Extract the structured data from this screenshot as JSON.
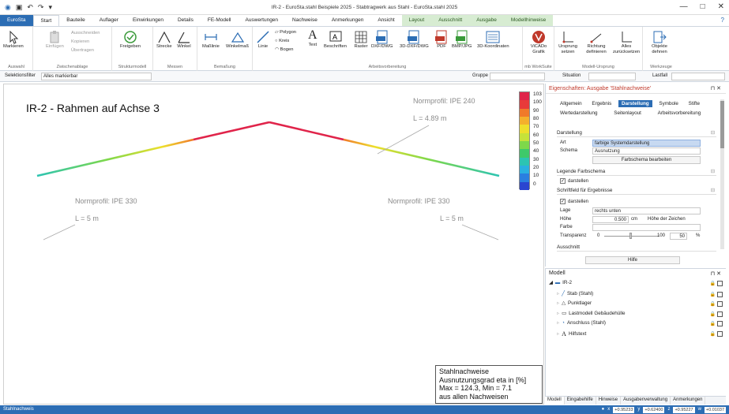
{
  "window": {
    "title": "IR-2 - EuroSta.stahl Beispiele 2025 - Stabtragwerk aus Stahl - EuroSta.stahl 2025",
    "quick_access": [
      "↶",
      "↷",
      "▾"
    ],
    "win_buttons": [
      "—",
      "□",
      "✕"
    ]
  },
  "ribbon_tabs": {
    "file": "EuroSta",
    "items": [
      "Start",
      "Bauteile",
      "Auflager",
      "Einwirkungen",
      "Details",
      "FE-Modell",
      "Auswertungen",
      "Nachweise",
      "Anmerkungen",
      "Ansicht"
    ],
    "contextual": [
      "Layout",
      "Ausschnitt",
      "Ausgabe",
      "Modellhinweise"
    ],
    "help": "?"
  },
  "ribbon": {
    "auswahl": {
      "label": "Auswahl",
      "markieren": "Markieren"
    },
    "zwischenablage": {
      "label": "Zwischenablage",
      "einfuegen": "Einfügen",
      "ausschneiden": "Ausschneiden",
      "kopieren": "Kopieren",
      "uebertragen": "Übertragen"
    },
    "strukturmodell": {
      "label": "Strukturmodell",
      "freigeben": "Freigeben"
    },
    "messen": {
      "label": "Messen",
      "strecke": "Strecke",
      "winkel": "Winkel"
    },
    "bemassung": {
      "label": "Bemaßung",
      "masslinie": "Maßlinie",
      "winkelmass": "Winkelmaß"
    },
    "arbeitsvorbereitung": {
      "label": "Arbeitsvorbereitung",
      "linie": "Linie",
      "polygon": "Polygon",
      "kreis": "Kreis",
      "bogen": "Bogen",
      "text": "Text",
      "beschriften": "Beschriften",
      "raster": "Raster",
      "dxf": "DXF/DWG",
      "dxf3d": "3D-DXF/DWG",
      "pdf": "PDF",
      "bmp": "BMP/JPG",
      "koord3d": "3D-Koordinaten"
    },
    "mbworksuite": {
      "label": "mb WorkSuite",
      "vicado": "ViCADo Grafik"
    },
    "modellursprung": {
      "label": "Modell-Ursprung",
      "ursprung": "Ursprung setzen",
      "richtung": "Richtung definieren",
      "alles": "Alles zurücksetzen"
    },
    "werkzeuge": {
      "label": "Werkzeuge",
      "objekte": "Objekte dehnen"
    }
  },
  "filterbar": {
    "selektionsfilter_label": "Selektionsfilter",
    "selektionsfilter_value": "Alles markierbar",
    "gruppe_label": "Gruppe",
    "situation_label": "Situation",
    "lastfall_label": "Lastfall"
  },
  "canvas": {
    "title": "IR-2 - Rahmen auf Achse 3",
    "annotations": {
      "top_profile": "Normprofil: IPE 240",
      "top_length": "L = 4.89 m",
      "left_profile": "Normprofil: IPE 330",
      "left_length": "L = 5 m",
      "right_profile": "Normprofil: IPE 330",
      "right_length": "L = 5 m"
    },
    "legend": {
      "labels": [
        "103",
        "100",
        "90",
        "80",
        "70",
        "60",
        "50",
        "40",
        "30",
        "20",
        "10",
        "0"
      ],
      "colors": [
        "#e0244a",
        "#e83a3a",
        "#f07a2a",
        "#f4b02c",
        "#eedf2c",
        "#c6e23a",
        "#7ed84a",
        "#3ec96a",
        "#2cc4b2",
        "#2ab0e0",
        "#2a7fe0",
        "#2a45d0"
      ]
    },
    "result": {
      "line1": "Stahlnachweise",
      "line2": "Ausnutzungsgrad eta in [%]",
      "line3": "Max = 124.3, Min = 7.1",
      "line4": "aus allen Nachweisen"
    }
  },
  "properties": {
    "title": "Eigenschaften: Ausgabe 'Stahlnachweise'",
    "tabs_row1": [
      "Allgemein",
      "Ergebnis",
      "Darstellung",
      "Symbole",
      "Stifte"
    ],
    "tabs_row2": [
      "Wertedarstellung",
      "Seitenlayout",
      "Arbeitsvorbereitung"
    ],
    "sec_darstellung": "Darstellung",
    "art_label": "Art",
    "art_value": "farbige Systemdarstellung",
    "schema_label": "Schema",
    "schema_value": "Ausnutzung",
    "farbschema_button": "Farbschema bearbeiten",
    "sec_legende": "Legende Farbschema",
    "legende_darstellen": "darstellen",
    "sec_schriftfeld": "Schriftfeld für Ergebnisse",
    "schriftfeld_darstellen": "darstellen",
    "lage_label": "Lage",
    "lage_value": "rechts unten",
    "hoehe_label": "Höhe",
    "hoehe_value": "0.500",
    "hoehe_unit": "cm",
    "hoehe_mode": "Höhe der Zeichen",
    "farbe_label": "Farbe",
    "transparenz_label": "Transparenz",
    "transparenz_min": "0",
    "transparenz_max": "100",
    "transparenz_value": "50",
    "transparenz_unit": "%",
    "sec_ausschnitt": "Ausschnitt",
    "hilfe_button": "Hilfe"
  },
  "model": {
    "title": "Modell",
    "root": "IR-2",
    "items": [
      "Stab (Stahl)",
      "Punktlager",
      "Lastmodell Gebäudehülle",
      "Anschluss (Stahl)",
      "Hilfstext"
    ]
  },
  "bottom_tabs": [
    "Modell",
    "Eingabehilfe",
    "Hinweise",
    "Ausgabenverwaltung",
    "Anmerkungen"
  ],
  "status": {
    "left": "Stahlnachweis",
    "x": "+0.95233",
    "y": "+0.62400",
    "z": "+0.95227",
    "w": "+0.01037"
  }
}
